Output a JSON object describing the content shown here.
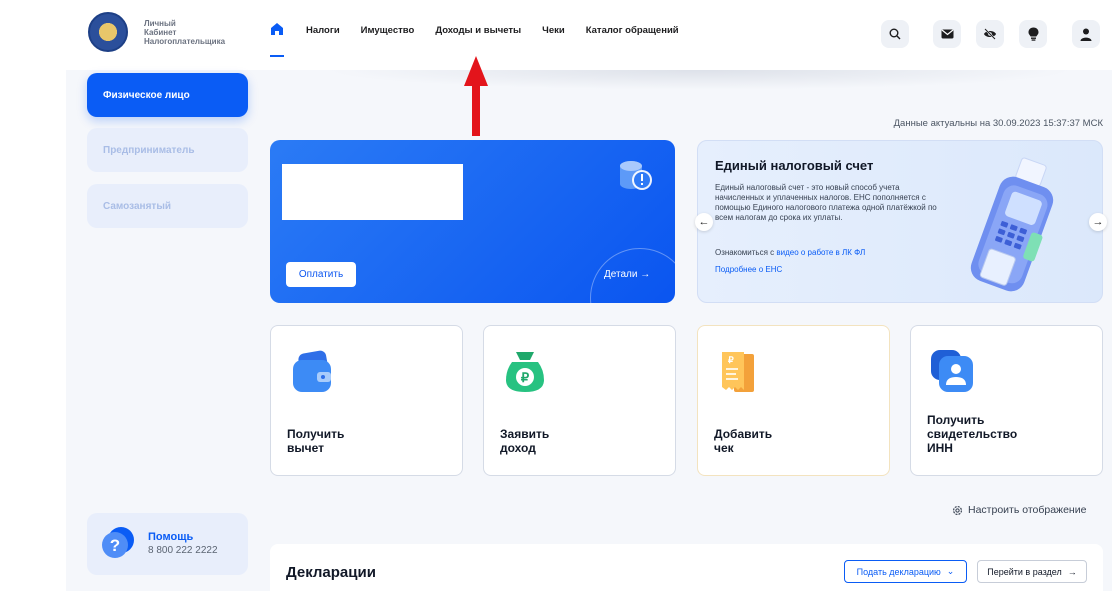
{
  "header": {
    "logo_lines": [
      "Личный",
      "Кабинет",
      "Налогоплательщика"
    ],
    "nav_items": [
      "Налоги",
      "Имущество",
      "Доходы и вычеты",
      "Чеки",
      "Каталог обращений"
    ],
    "icons": [
      "search-icon",
      "mail-icon",
      "eye-off-icon",
      "bulb-icon",
      "user-icon"
    ]
  },
  "sidebar": {
    "items": [
      {
        "label": "Физическое лицо",
        "active": true
      },
      {
        "label": "Предприниматель",
        "active": false
      },
      {
        "label": "Самозанятый",
        "active": false
      }
    ],
    "help": {
      "title": "Помощь",
      "phone": "8 800 222 2222"
    }
  },
  "actual_info": "Данные актуальны на 30.09.2023 15:37:37 МСК",
  "balance_card": {
    "pay_label": "Оплатить",
    "details_label": "Детали"
  },
  "ens_card": {
    "title": "Единый налоговый счет",
    "text": "Единый налоговый счет - это новый способ учета начисленных и уплаченных налогов. ЕНС пополняется с помощью Единого налогового платежа одной платёжкой по всем налогам до срока их уплаты.",
    "link_prefix": "Ознакомиться с ",
    "link_text": "видео о работе в ЛК ФЛ",
    "more_link": "Подробнее о ЕНС"
  },
  "actions": [
    {
      "label_lines": [
        "Получить",
        "вычет"
      ],
      "icon": "wallet-icon"
    },
    {
      "label_lines": [
        "Заявить",
        "доход"
      ],
      "icon": "ruble-bag-icon"
    },
    {
      "label_lines": [
        "Добавить",
        "чек"
      ],
      "icon": "receipt-icon"
    },
    {
      "label_lines": [
        "Получить",
        "свидетельство",
        "ИНН"
      ],
      "icon": "id-card-icon"
    }
  ],
  "configure_label": "Настроить отображение",
  "declarations": {
    "title": "Декларации",
    "submit_label": "Подать декларацию",
    "go_label": "Перейти в раздел"
  },
  "colors": {
    "accent": "#0a5cf5",
    "annotation_arrow": "#e3141b"
  }
}
